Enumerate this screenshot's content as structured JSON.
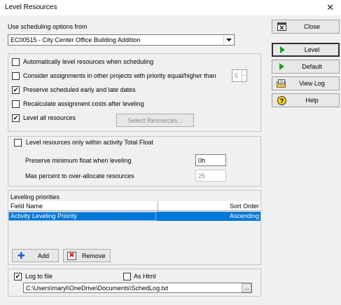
{
  "window": {
    "title": "Level Resources",
    "close_glyph": "✕"
  },
  "scheduling_options": {
    "label": "Use scheduling options from",
    "selected": "EC00515 - City Center Office Building Addition"
  },
  "options": {
    "auto_level": {
      "label": "Automatically level resources when scheduling",
      "checked": false
    },
    "consider_assignments": {
      "label": "Consider assignments in other projects with priority equal/higher than",
      "checked": false,
      "priority_value": "5"
    },
    "preserve_dates": {
      "label": "Preserve scheduled early and late dates",
      "checked": true
    },
    "recalc_costs": {
      "label": "Recalculate assignment costs after leveling",
      "checked": false
    },
    "level_all": {
      "label": "Level all resources",
      "checked": true
    },
    "select_resources_label": "Select Resources..."
  },
  "float": {
    "within_total_float": {
      "label": "Level resources only within activity Total Float",
      "checked": false
    },
    "min_float_label": "Preserve minimum float when leveling",
    "min_float_value": "0h",
    "max_percent_label": "Max percent to over-allocate resources",
    "max_percent_value": "25"
  },
  "priorities": {
    "title": "Leveling priorities",
    "columns": {
      "field": "Field Name",
      "sort": "Sort Order"
    },
    "rows": [
      {
        "field": "Activity Leveling Priority",
        "sort": "Ascending"
      }
    ],
    "add_label": "Add",
    "remove_label": "Remove"
  },
  "log": {
    "log_to_file": {
      "label": "Log to file",
      "checked": true
    },
    "as_html": {
      "label": "As Html",
      "checked": false
    },
    "path": "C:\\Users\\maryl\\OneDrive\\Documents\\SchedLog.txt",
    "browse": "..."
  },
  "buttons": {
    "close": "Close",
    "level": "Level",
    "default": "Default",
    "view_log": "View Log",
    "help": "Help"
  },
  "colors": {
    "selection": "#0078d7",
    "play_green": "#1aa01a"
  }
}
